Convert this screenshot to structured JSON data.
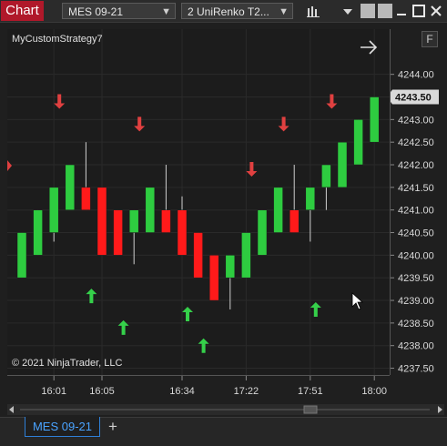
{
  "window": {
    "title_tab": "Chart",
    "instrument": "MES 09-21",
    "bar_type": "2 UniRenko T2..."
  },
  "chart": {
    "strategy_label": "MyCustomStrategy7",
    "copyright": "© 2021 NinjaTrader, LLC",
    "f_button": "F",
    "last_price_label": "4243.50",
    "colors": {
      "up": "#2ecc40",
      "down": "#ff1a1a",
      "arrow_up": "#35d04a",
      "arrow_down": "#e04040",
      "background": "#1c1c1c"
    }
  },
  "bottom_tabs": {
    "active": "MES 09-21",
    "add": "+"
  },
  "chart_data": {
    "type": "candlestick",
    "y_ticks": [
      "4244.00",
      "4243.50",
      "4243.00",
      "4242.50",
      "4242.00",
      "4241.50",
      "4241.00",
      "4240.50",
      "4240.00",
      "4239.50",
      "4239.00",
      "4238.50",
      "4238.00",
      "4237.50"
    ],
    "x_ticks": [
      "16:01",
      "16:05",
      "16:34",
      "17:22",
      "17:51",
      "18:00"
    ],
    "ylim": [
      4237.35,
      4245.0
    ],
    "bars": [
      {
        "open": 4239.5,
        "close": 4240.5,
        "high": 4240.5,
        "low": 4239.5
      },
      {
        "open": 4240.0,
        "close": 4241.0,
        "high": 4241.0,
        "low": 4240.0
      },
      {
        "open": 4240.5,
        "close": 4241.5,
        "high": 4241.5,
        "low": 4240.3
      },
      {
        "open": 4241.0,
        "close": 4242.0,
        "high": 4242.0,
        "low": 4241.0
      },
      {
        "open": 4241.5,
        "close": 4241.0,
        "high": 4242.5,
        "low": 4241.0
      },
      {
        "open": 4241.5,
        "close": 4240.0,
        "high": 4241.5,
        "low": 4240.0
      },
      {
        "open": 4241.0,
        "close": 4240.0,
        "high": 4241.0,
        "low": 4240.0
      },
      {
        "open": 4240.5,
        "close": 4241.0,
        "high": 4241.0,
        "low": 4239.8
      },
      {
        "open": 4240.5,
        "close": 4241.5,
        "high": 4241.5,
        "low": 4240.5
      },
      {
        "open": 4241.0,
        "close": 4240.5,
        "high": 4242.0,
        "low": 4240.5
      },
      {
        "open": 4241.0,
        "close": 4240.0,
        "high": 4241.3,
        "low": 4240.0
      },
      {
        "open": 4240.5,
        "close": 4239.5,
        "high": 4240.5,
        "low": 4239.5
      },
      {
        "open": 4240.0,
        "close": 4239.0,
        "high": 4240.0,
        "low": 4239.0
      },
      {
        "open": 4239.5,
        "close": 4240.0,
        "high": 4240.0,
        "low": 4238.8
      },
      {
        "open": 4239.5,
        "close": 4240.5,
        "high": 4240.5,
        "low": 4239.5
      },
      {
        "open": 4240.0,
        "close": 4241.0,
        "high": 4241.0,
        "low": 4240.0
      },
      {
        "open": 4240.5,
        "close": 4241.5,
        "high": 4241.5,
        "low": 4240.5
      },
      {
        "open": 4241.0,
        "close": 4240.5,
        "high": 4242.0,
        "low": 4240.5
      },
      {
        "open": 4241.0,
        "close": 4241.5,
        "high": 4241.5,
        "low": 4240.3
      },
      {
        "open": 4241.5,
        "close": 4242.0,
        "high": 4242.0,
        "low": 4241.0
      },
      {
        "open": 4241.5,
        "close": 4242.5,
        "high": 4242.5,
        "low": 4241.5
      },
      {
        "open": 4242.0,
        "close": 4243.0,
        "high": 4243.0,
        "low": 4242.0
      },
      {
        "open": 4242.5,
        "close": 4243.5,
        "high": 4243.5,
        "low": 4242.5
      }
    ],
    "signals": [
      {
        "bar": 2,
        "dir": "down",
        "price": 4243.4
      },
      {
        "bar": 4,
        "dir": "up",
        "price": 4239.1
      },
      {
        "bar": 7,
        "dir": "down",
        "price": 4242.9
      },
      {
        "bar": 6,
        "dir": "up",
        "price": 4238.4
      },
      {
        "bar": 10,
        "dir": "up",
        "price": 4238.7
      },
      {
        "bar": 11,
        "dir": "up",
        "price": 4238.0
      },
      {
        "bar": 14,
        "dir": "down",
        "price": 4241.9
      },
      {
        "bar": 16,
        "dir": "down",
        "price": 4242.9
      },
      {
        "bar": 19,
        "dir": "down",
        "price": 4243.4
      },
      {
        "bar": 18,
        "dir": "up",
        "price": 4238.8
      }
    ]
  }
}
